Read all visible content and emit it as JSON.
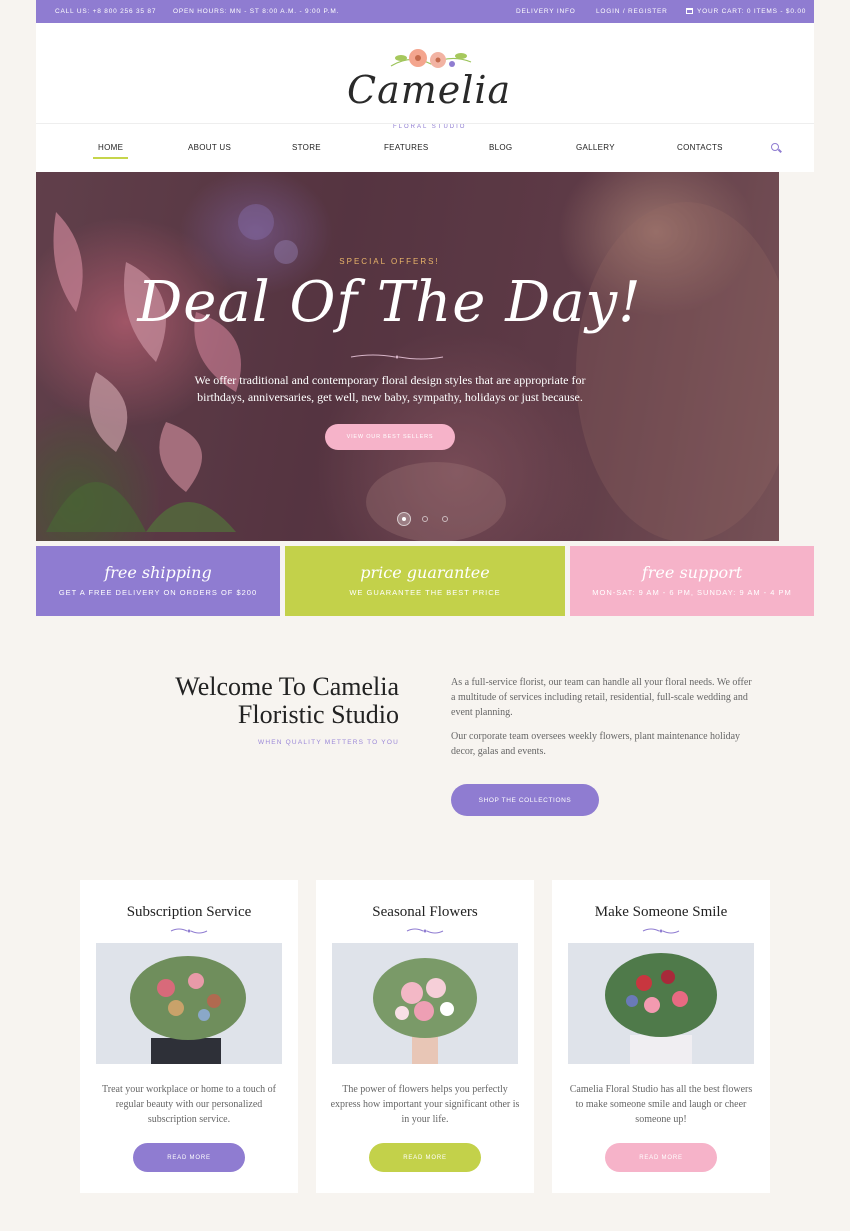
{
  "topbar": {
    "call": "CALL US: +8 800 256 35 87",
    "hours": "OPEN HOURS: MN - ST 8:00 A.M. - 9:00 P.M.",
    "delivery": "DELIVERY INFO",
    "login": "LOGIN / REGISTER",
    "cart": "YOUR CART:   0 ITEMS - $0.00"
  },
  "logo": {
    "name": "Camelia",
    "sub": "FLORAL STUDIO"
  },
  "nav": [
    {
      "label": "HOME",
      "active": true
    },
    {
      "label": "ABOUT US"
    },
    {
      "label": "STORE"
    },
    {
      "label": "FEATURES"
    },
    {
      "label": "BLOG"
    },
    {
      "label": "GALLERY"
    },
    {
      "label": "CONTACTS"
    }
  ],
  "hero": {
    "kicker": "SPECIAL OFFERS!",
    "title": "Deal Of The Day!",
    "text": "We offer traditional and contemporary floral design styles that are appropriate for birthdays, anniversaries, get well, new baby, sympathy, holidays or just because.",
    "button": "VIEW OUR BEST SELLERS",
    "slides": 3,
    "active_slide": 1
  },
  "features": [
    {
      "title": "free shipping",
      "sub": "GET A FREE DELIVERY ON ORDERS OF $200",
      "color": "#8f7cd1"
    },
    {
      "title": "price guarantee",
      "sub": "WE GUARANTEE THE BEST PRICE",
      "color": "#c3d14a"
    },
    {
      "title": "free support",
      "sub": "MON-SAT: 9 AM - 6 PM, SUNDAY: 9 AM - 4 PM",
      "color": "#f6b3c9"
    }
  ],
  "welcome": {
    "title_line1": "Welcome To Camelia",
    "title_line2": "Floristic Studio",
    "subtitle": "WHEN QUALITY METTERS TO YOU",
    "p1": "As a full-service florist, our team can handle all your floral needs. We offer a multitude of services including retail, residential, full-scale wedding and event planning.",
    "p2": "Our corporate team oversees weekly flowers, plant maintenance holiday decor, galas and events.",
    "button": "SHOP THE COLLECTIONS"
  },
  "cards": [
    {
      "title": "Subscription Service",
      "text": "Treat your workplace or home to a touch of regular beauty with our personalized subscription service.",
      "button": "READ MORE",
      "color": "#8f7cd1"
    },
    {
      "title": "Seasonal Flowers",
      "text": "The power of flowers helps you perfectly express how important your significant other is in your life.",
      "button": "READ MORE",
      "color": "#c3d14a"
    },
    {
      "title": "Make Someone Smile",
      "text": "Camelia Floral Studio has all the best flowers to make someone smile and laugh or cheer someone up!",
      "button": "READ MORE",
      "color": "#f6b3c9"
    }
  ],
  "colors": {
    "brand_purple": "#8f7cd1",
    "brand_green": "#c3d14a",
    "brand_pink": "#f6b3c9",
    "background": "#f7f4f0"
  }
}
